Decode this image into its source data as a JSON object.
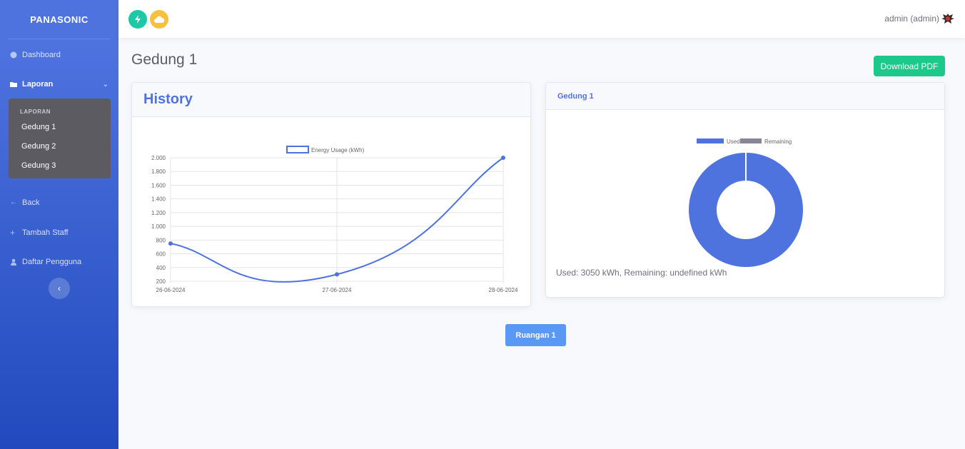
{
  "brand": "PANASONIC",
  "sidebar": {
    "dashboard": "Dashboard",
    "laporan": "Laporan",
    "submenu_header": "LAPORAN",
    "submenu_items": [
      "Gedung 1",
      "Gedung 2",
      "Gedung 3"
    ],
    "back": "Back",
    "tambah_staff": "Tambah Staff",
    "daftar_pengguna": "Daftar Pengguna"
  },
  "topbar": {
    "user": "admin (admin)",
    "icons": [
      "lightning-icon",
      "cloud-icon"
    ],
    "icon_colors": [
      "#1cc8a6",
      "#f6c23e"
    ]
  },
  "page": {
    "title": "Gedung 1",
    "download_label": "Download PDF",
    "room_button": "Ruangan 1"
  },
  "history_card": {
    "title": "History"
  },
  "gedung_card": {
    "title": "Gedung 1",
    "summary": "Used: 3050 kWh, Remaining: undefined kWh"
  },
  "chart_data": [
    {
      "type": "line",
      "title": "",
      "x": [
        "26-06-2024",
        "27-06-2024",
        "28-06-2024"
      ],
      "series": [
        {
          "name": "Energy Usage (kWh)",
          "values": [
            750,
            300,
            2000
          ],
          "color": "#4e73df"
        }
      ],
      "y_ticks": [
        "2.000",
        "1.800",
        "1.600",
        "1.400",
        "1.200",
        "1.000",
        "800",
        "600",
        "400",
        "200"
      ],
      "ylim": [
        200,
        2000
      ],
      "grid": true,
      "legend": "top-center"
    },
    {
      "type": "pie",
      "style": "doughnut",
      "labels": [
        "Used",
        "Remaining"
      ],
      "values": [
        3050,
        0
      ],
      "colors": [
        "#4e73df",
        "#858796"
      ],
      "legend": "top-center"
    }
  ]
}
